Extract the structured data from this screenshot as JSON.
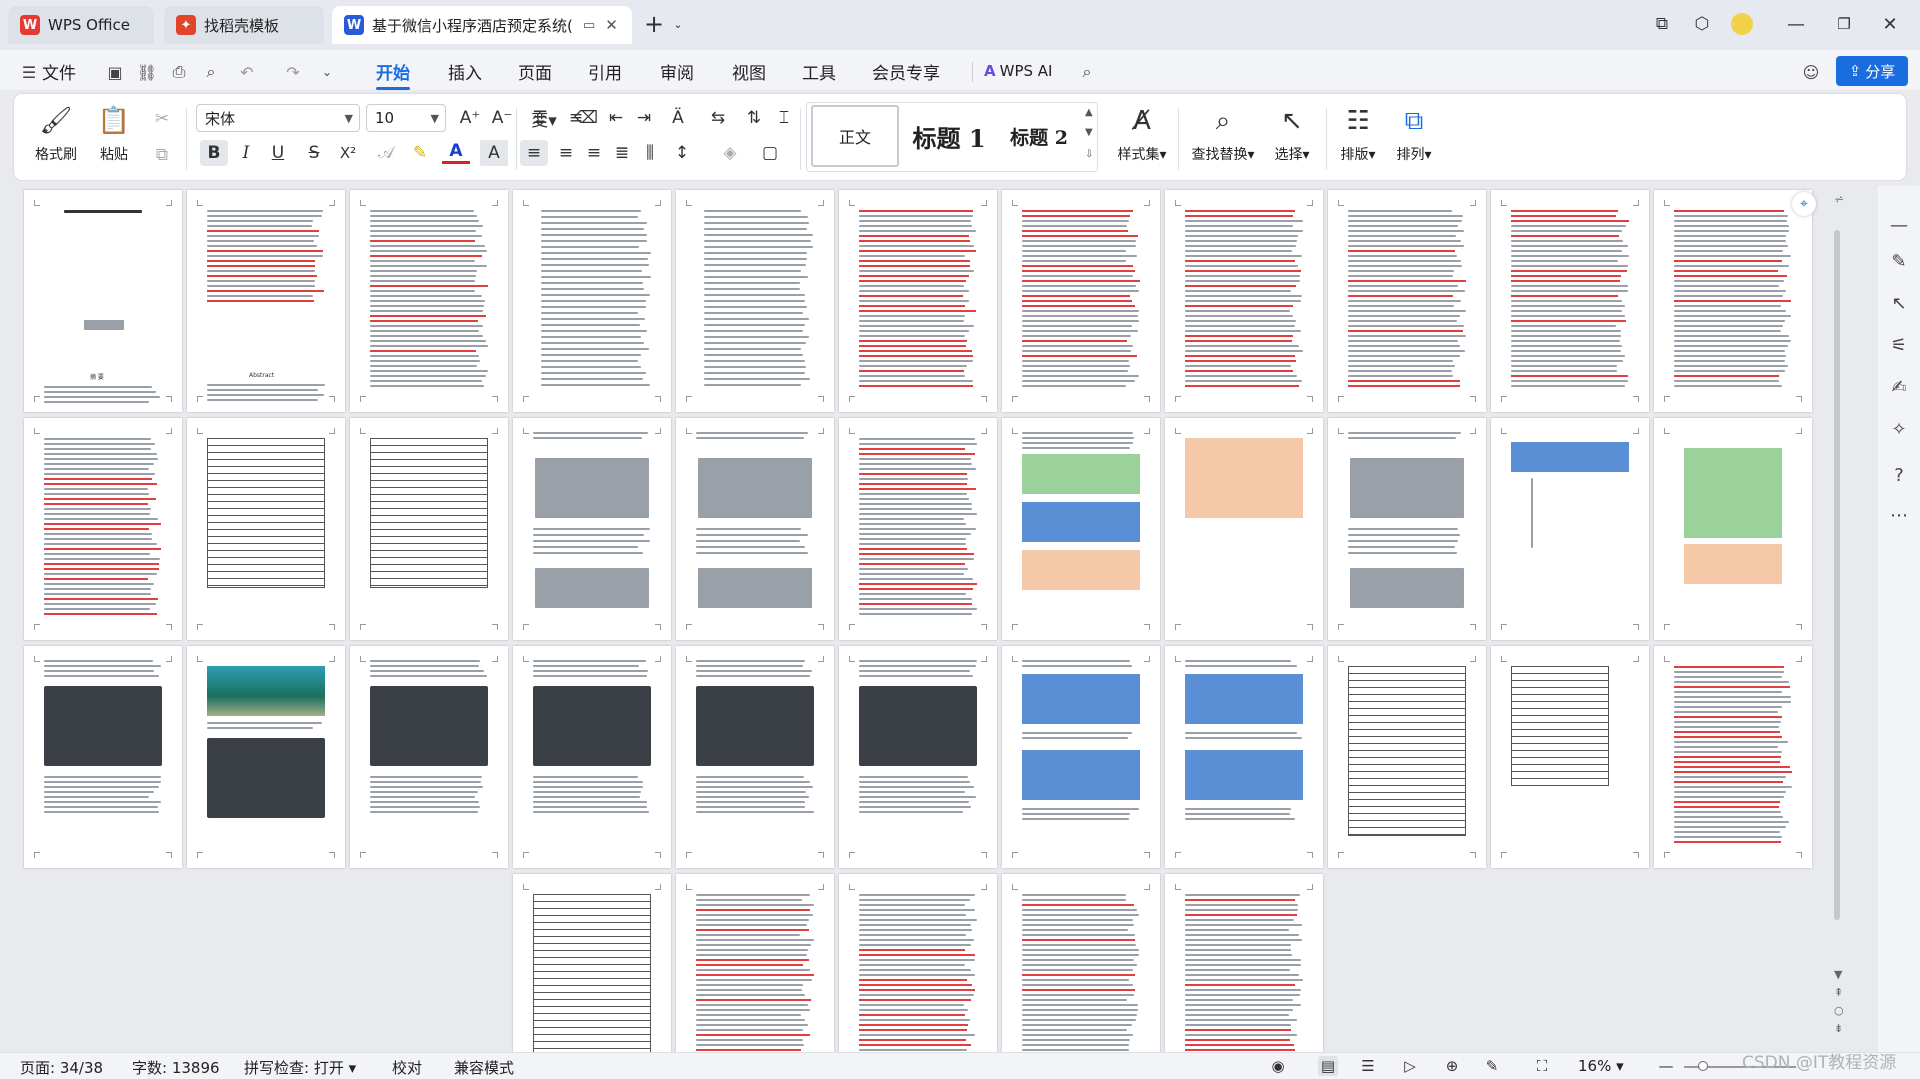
{
  "tabs": [
    {
      "label": "WPS Office",
      "active": false
    },
    {
      "label": "找稻壳模板",
      "active": false
    },
    {
      "label": "基于微信小程序酒店预定系统(",
      "active": true
    }
  ],
  "new_tab_symbol": "+",
  "menu": {
    "file": "文件",
    "items": [
      "开始",
      "插入",
      "页面",
      "引用",
      "审阅",
      "视图",
      "工具",
      "会员专享"
    ],
    "active": "开始",
    "wps_ai": "WPS AI",
    "share": "分享"
  },
  "ribbon": {
    "format_painter": "格式刷",
    "paste": "粘贴",
    "font_name": "宋体",
    "font_size": "10",
    "styles": [
      "正文",
      "标题 1",
      "标题 2"
    ],
    "style_set": "样式集",
    "find_replace": "查找替换",
    "select": "选择",
    "typeset": "排版",
    "arrange": "排列",
    "bold": "B",
    "italic": "I",
    "underline": "U",
    "strike": "S",
    "superscript": "X²",
    "font_color_letter": "A",
    "char_shade": "A"
  },
  "status": {
    "page": "页面: 34/38",
    "words": "字数: 13896",
    "spellcheck": "拼写检查: 打开",
    "proofread": "校对",
    "compat": "兼容模式",
    "zoom": "16%"
  },
  "document": {
    "page_count": 38,
    "grid_columns": 11,
    "first_page_heading": "摘 要",
    "abstract_heading": "Abstract"
  },
  "watermark": "CSDN @IT教程资源",
  "colors": {
    "accent": "#1a6dde",
    "tab_active_bg": "#ffffff",
    "ribbon_bg": "#ffffff",
    "doc_bg": "#e8eaee",
    "wps_red": "#e53935",
    "writer_blue": "#2a5bd7"
  }
}
